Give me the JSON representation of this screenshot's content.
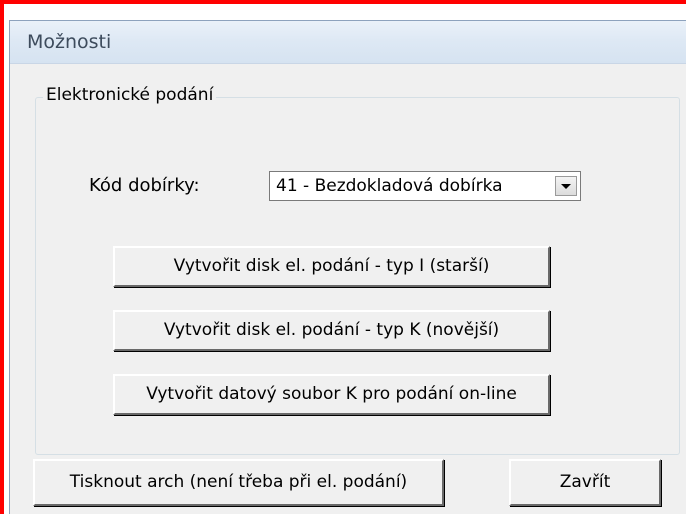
{
  "dialog": {
    "title": "Možnosti"
  },
  "group": {
    "label": "Elektronické podání"
  },
  "kod_dobirky": {
    "label": "Kód dobírky:",
    "selected": "41 - Bezdokladová dobírka"
  },
  "buttons": {
    "typ_i": "Vytvořit disk el. podání - typ I (starší)",
    "typ_k": "Vytvořit disk el. podání - typ K (novější)",
    "online": "Vytvořit datový soubor K pro podání on-line",
    "tisk": "Tisknout arch (není třeba při el. podání)",
    "zavrit": "Zavřít"
  },
  "colors": {
    "frame": "#ff0000",
    "dialog_bg": "#f0f0f0",
    "titlebar": "#dde8f4"
  }
}
